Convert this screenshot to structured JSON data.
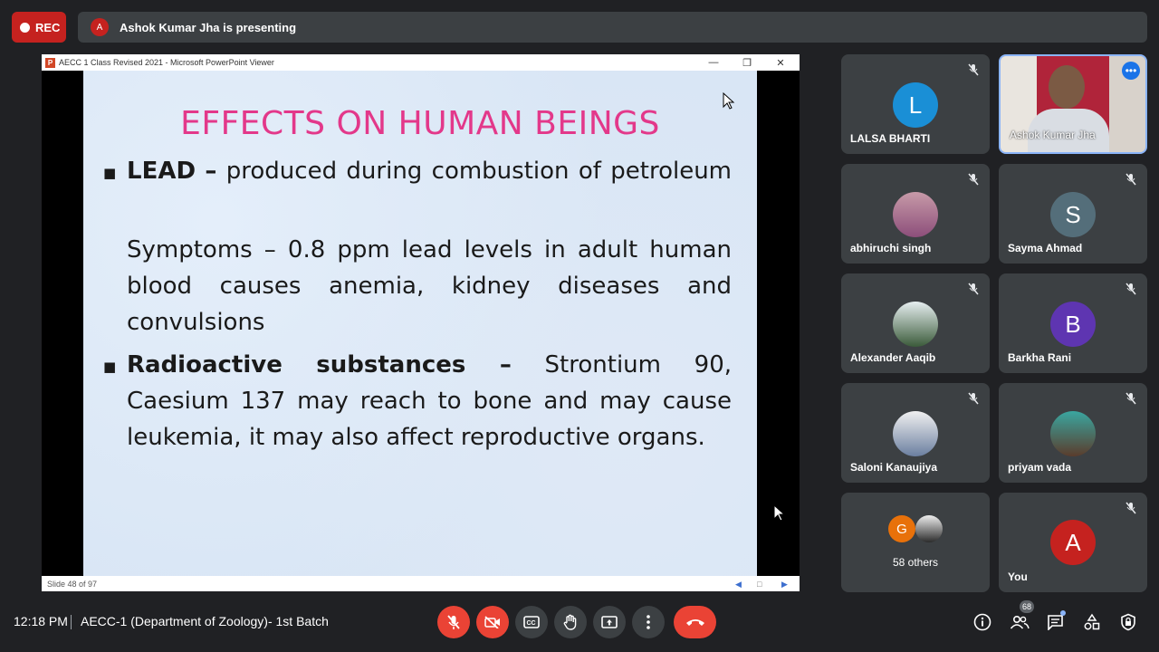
{
  "top": {
    "rec_label": "REC",
    "presenter_initial": "A",
    "presenting_text": "Ashok Kumar Jha is presenting"
  },
  "window": {
    "title": "AECC 1 Class Revised 2021 - Microsoft PowerPoint Viewer",
    "status": "Slide 48 of 97"
  },
  "slide": {
    "title": "EFFECTS  ON HUMAN BEINGS",
    "lead_term": "LEAD",
    "lead_dash": "–",
    "lead_text": "produced during combustion of petroleum",
    "symptoms": "Symptoms – 0.8 ppm lead levels in adult human blood causes anemia, kidney diseases and convulsions",
    "radio_term": "Radioactive substances –",
    "radio_text": "Strontium  90, Caesium 137  may reach to bone   and may cause leukemia, it may also affect reproductive organs."
  },
  "participants": [
    {
      "name": "LALSA BHARTI",
      "initial": "L",
      "color": "#1a8fd6"
    },
    {
      "name": "Ashok Kumar Jha"
    },
    {
      "name": "abhiruchi singh"
    },
    {
      "name": "Sayma Ahmad",
      "initial": "S",
      "color": "#546e7a"
    },
    {
      "name": "Alexander Aaqib"
    },
    {
      "name": "Barkha Rani",
      "initial": "B",
      "color": "#5e35b1"
    },
    {
      "name": "Saloni Kanaujiya"
    },
    {
      "name": "priyam vada"
    },
    {
      "name": "58 others",
      "initial": "G",
      "color": "#e8710a"
    },
    {
      "name": "You",
      "initial": "A",
      "color": "#c5221f"
    }
  ],
  "bottom": {
    "time": "12:18 PM",
    "meeting": "AECC-1 (Department of Zoology)- 1st Batch",
    "people_count": "68"
  }
}
